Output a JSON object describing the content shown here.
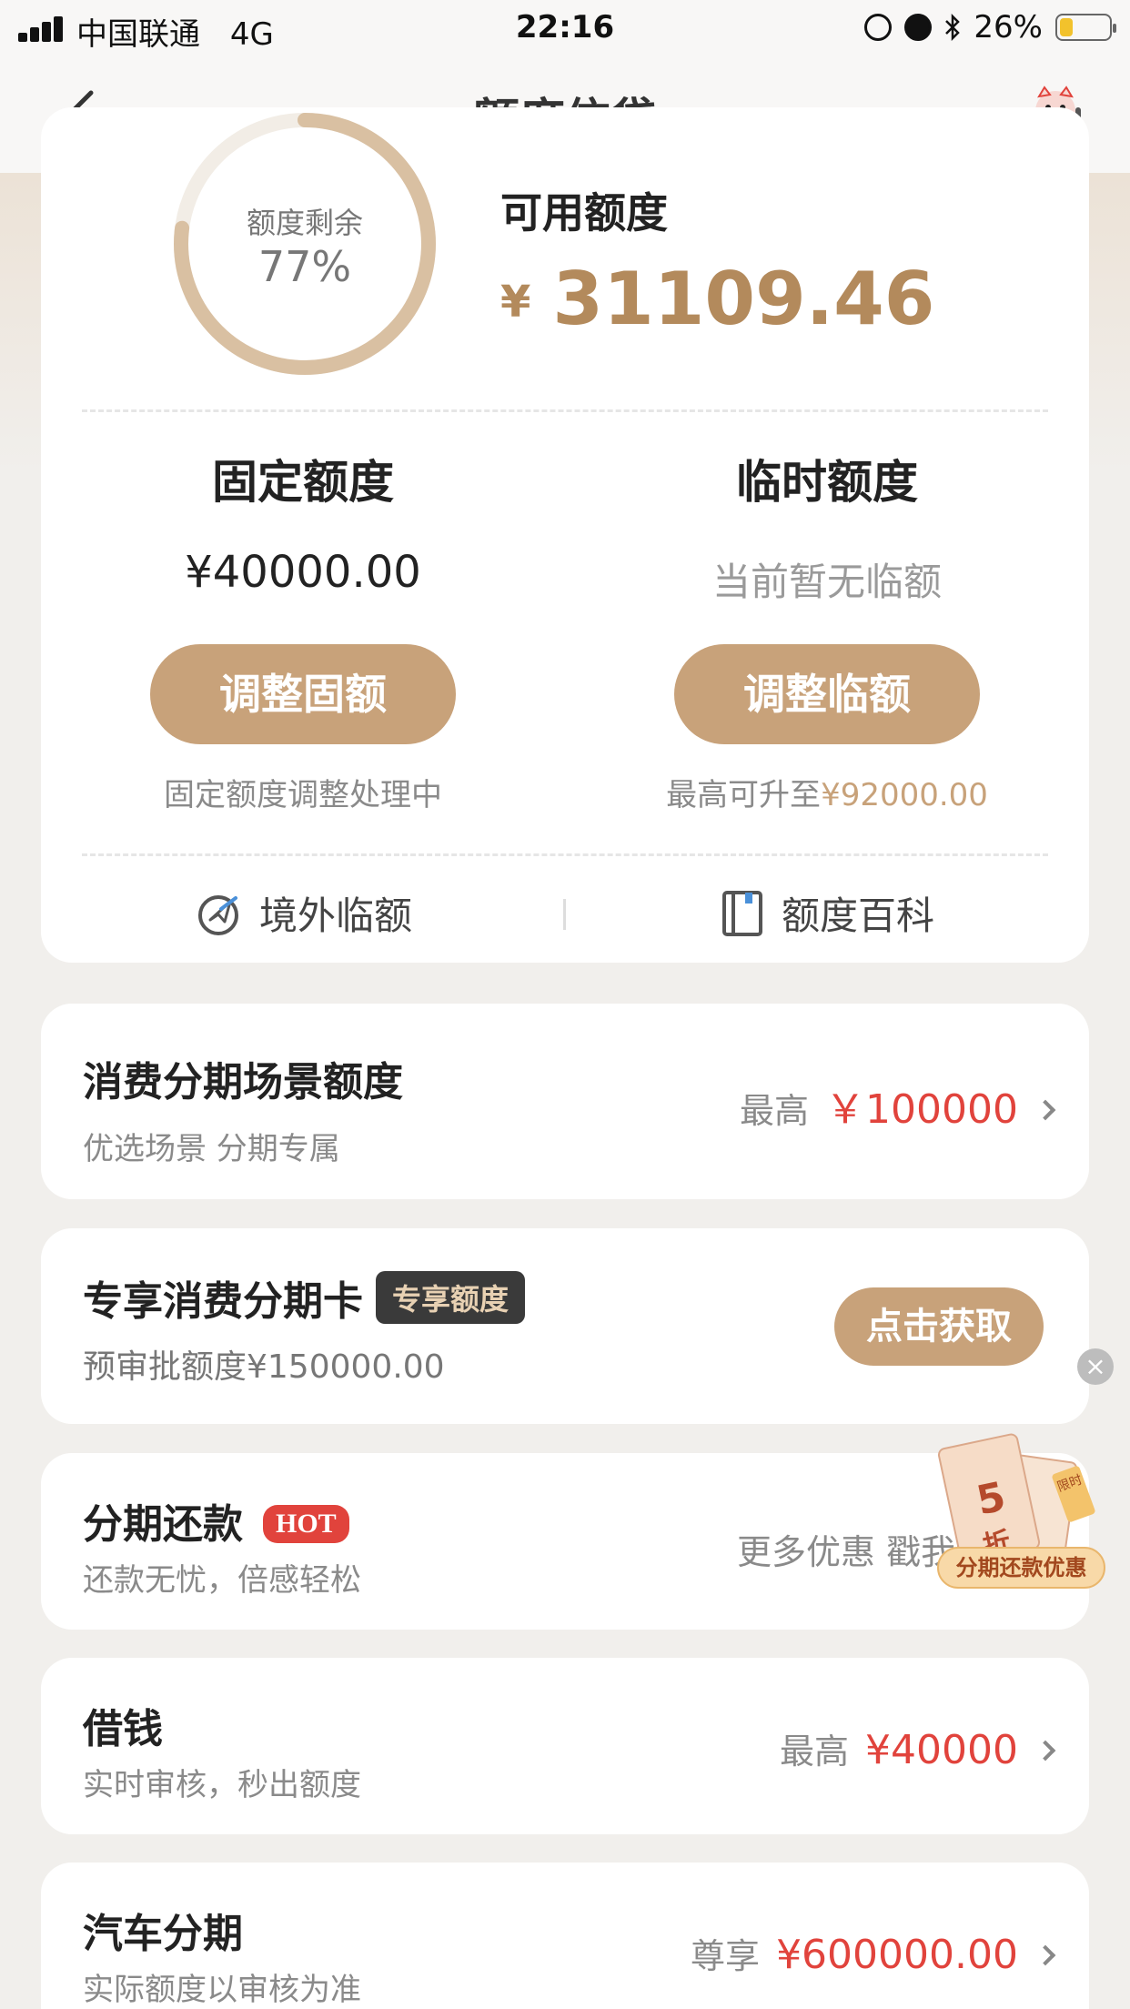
{
  "status_bar": {
    "carrier": "中国联通",
    "network": "4G",
    "time": "22:16",
    "battery": "26%",
    "battery_level": 0.26
  },
  "nav": {
    "title": "额度信贷"
  },
  "quota_card": {
    "ring_label": "额度剩余",
    "ring_percent": "77%",
    "ring_value": 0.77,
    "available_label": "可用额度",
    "currency": "¥",
    "available_amount": "31109.46",
    "fixed": {
      "title": "固定额度",
      "value": "¥40000.00",
      "button": "调整固额",
      "note": "固定额度调整处理中"
    },
    "temp": {
      "title": "临时额度",
      "value": "当前暂无临额",
      "button": "调整临额",
      "note_prefix": "最高可升至",
      "note_amount": "¥92000.00"
    },
    "links": {
      "overseas": "境外临额",
      "wiki": "额度百科"
    }
  },
  "rows": {
    "installment_scene": {
      "title": "消费分期场景额度",
      "subtitle": "优选场景 分期专属",
      "prefix": "最高",
      "amount": "￥100000"
    },
    "exclusive_card": {
      "title": "专享消费分期卡",
      "tag": "专享额度",
      "subtitle": "预审批额度¥150000.00",
      "button": "点击获取"
    },
    "installment_repay": {
      "title": "分期还款",
      "tag": "HOT",
      "subtitle": "还款无忧，倍感轻松",
      "right_text": "更多优惠 戳我参"
    },
    "borrow": {
      "title": "借钱",
      "subtitle": "实时审核，秒出额度",
      "prefix": "最高",
      "amount": "¥40000"
    },
    "car": {
      "title": "汽车分期",
      "subtitle": "实际额度以审核为准",
      "prefix": "尊享",
      "amount": "¥600000.00"
    }
  },
  "promo": {
    "number": "5",
    "unit": "折",
    "flag": "限时",
    "label": "分期还款优惠"
  },
  "colors": {
    "accent_gold": "#c8a27a",
    "amount_red": "#e1433c",
    "tag_dark": "#3a3a3a"
  }
}
